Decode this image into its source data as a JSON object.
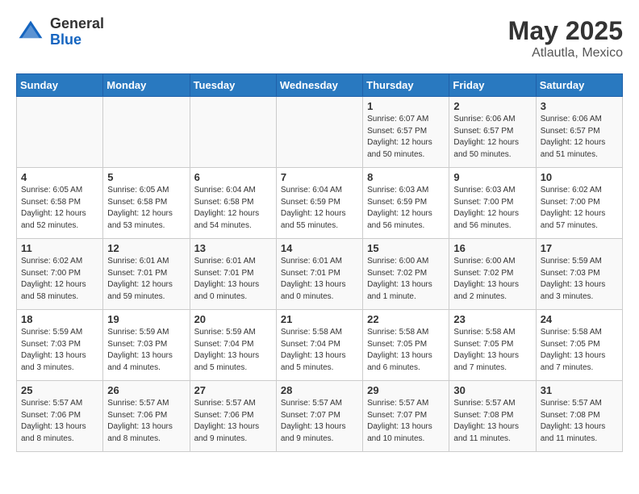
{
  "header": {
    "logo": {
      "general": "General",
      "blue": "Blue"
    },
    "title": "May 2025",
    "location": "Atlautla, Mexico"
  },
  "weekdays": [
    "Sunday",
    "Monday",
    "Tuesday",
    "Wednesday",
    "Thursday",
    "Friday",
    "Saturday"
  ],
  "weeks": [
    [
      {
        "day": null,
        "info": null
      },
      {
        "day": null,
        "info": null
      },
      {
        "day": null,
        "info": null
      },
      {
        "day": null,
        "info": null
      },
      {
        "day": "1",
        "info": "Sunrise: 6:07 AM\nSunset: 6:57 PM\nDaylight: 12 hours\nand 50 minutes."
      },
      {
        "day": "2",
        "info": "Sunrise: 6:06 AM\nSunset: 6:57 PM\nDaylight: 12 hours\nand 50 minutes."
      },
      {
        "day": "3",
        "info": "Sunrise: 6:06 AM\nSunset: 6:57 PM\nDaylight: 12 hours\nand 51 minutes."
      }
    ],
    [
      {
        "day": "4",
        "info": "Sunrise: 6:05 AM\nSunset: 6:58 PM\nDaylight: 12 hours\nand 52 minutes."
      },
      {
        "day": "5",
        "info": "Sunrise: 6:05 AM\nSunset: 6:58 PM\nDaylight: 12 hours\nand 53 minutes."
      },
      {
        "day": "6",
        "info": "Sunrise: 6:04 AM\nSunset: 6:58 PM\nDaylight: 12 hours\nand 54 minutes."
      },
      {
        "day": "7",
        "info": "Sunrise: 6:04 AM\nSunset: 6:59 PM\nDaylight: 12 hours\nand 55 minutes."
      },
      {
        "day": "8",
        "info": "Sunrise: 6:03 AM\nSunset: 6:59 PM\nDaylight: 12 hours\nand 56 minutes."
      },
      {
        "day": "9",
        "info": "Sunrise: 6:03 AM\nSunset: 7:00 PM\nDaylight: 12 hours\nand 56 minutes."
      },
      {
        "day": "10",
        "info": "Sunrise: 6:02 AM\nSunset: 7:00 PM\nDaylight: 12 hours\nand 57 minutes."
      }
    ],
    [
      {
        "day": "11",
        "info": "Sunrise: 6:02 AM\nSunset: 7:00 PM\nDaylight: 12 hours\nand 58 minutes."
      },
      {
        "day": "12",
        "info": "Sunrise: 6:01 AM\nSunset: 7:01 PM\nDaylight: 12 hours\nand 59 minutes."
      },
      {
        "day": "13",
        "info": "Sunrise: 6:01 AM\nSunset: 7:01 PM\nDaylight: 13 hours\nand 0 minutes."
      },
      {
        "day": "14",
        "info": "Sunrise: 6:01 AM\nSunset: 7:01 PM\nDaylight: 13 hours\nand 0 minutes."
      },
      {
        "day": "15",
        "info": "Sunrise: 6:00 AM\nSunset: 7:02 PM\nDaylight: 13 hours\nand 1 minute."
      },
      {
        "day": "16",
        "info": "Sunrise: 6:00 AM\nSunset: 7:02 PM\nDaylight: 13 hours\nand 2 minutes."
      },
      {
        "day": "17",
        "info": "Sunrise: 5:59 AM\nSunset: 7:03 PM\nDaylight: 13 hours\nand 3 minutes."
      }
    ],
    [
      {
        "day": "18",
        "info": "Sunrise: 5:59 AM\nSunset: 7:03 PM\nDaylight: 13 hours\nand 3 minutes."
      },
      {
        "day": "19",
        "info": "Sunrise: 5:59 AM\nSunset: 7:03 PM\nDaylight: 13 hours\nand 4 minutes."
      },
      {
        "day": "20",
        "info": "Sunrise: 5:59 AM\nSunset: 7:04 PM\nDaylight: 13 hours\nand 5 minutes."
      },
      {
        "day": "21",
        "info": "Sunrise: 5:58 AM\nSunset: 7:04 PM\nDaylight: 13 hours\nand 5 minutes."
      },
      {
        "day": "22",
        "info": "Sunrise: 5:58 AM\nSunset: 7:05 PM\nDaylight: 13 hours\nand 6 minutes."
      },
      {
        "day": "23",
        "info": "Sunrise: 5:58 AM\nSunset: 7:05 PM\nDaylight: 13 hours\nand 7 minutes."
      },
      {
        "day": "24",
        "info": "Sunrise: 5:58 AM\nSunset: 7:05 PM\nDaylight: 13 hours\nand 7 minutes."
      }
    ],
    [
      {
        "day": "25",
        "info": "Sunrise: 5:57 AM\nSunset: 7:06 PM\nDaylight: 13 hours\nand 8 minutes."
      },
      {
        "day": "26",
        "info": "Sunrise: 5:57 AM\nSunset: 7:06 PM\nDaylight: 13 hours\nand 8 minutes."
      },
      {
        "day": "27",
        "info": "Sunrise: 5:57 AM\nSunset: 7:06 PM\nDaylight: 13 hours\nand 9 minutes."
      },
      {
        "day": "28",
        "info": "Sunrise: 5:57 AM\nSunset: 7:07 PM\nDaylight: 13 hours\nand 9 minutes."
      },
      {
        "day": "29",
        "info": "Sunrise: 5:57 AM\nSunset: 7:07 PM\nDaylight: 13 hours\nand 10 minutes."
      },
      {
        "day": "30",
        "info": "Sunrise: 5:57 AM\nSunset: 7:08 PM\nDaylight: 13 hours\nand 11 minutes."
      },
      {
        "day": "31",
        "info": "Sunrise: 5:57 AM\nSunset: 7:08 PM\nDaylight: 13 hours\nand 11 minutes."
      }
    ]
  ]
}
